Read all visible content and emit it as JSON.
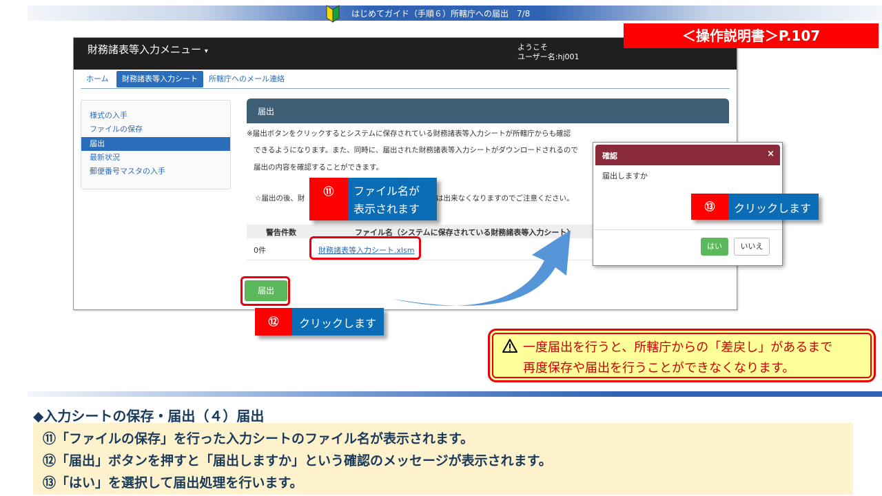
{
  "topbar": {
    "title": "はじめてガイド（手順６）所轄庁への届出　7/8"
  },
  "manual_ref": "＜操作説明書＞P.107",
  "app": {
    "title": "財務諸表等入力メニュー",
    "caret": "▾",
    "welcome_line1": "ようこそ",
    "welcome_line2": "ユーザー名:hj001"
  },
  "nav": {
    "home": "ホーム",
    "input_sheet": "財務諸表等入力シート",
    "mail": "所轄庁へのメール連絡"
  },
  "sidebar": {
    "items": [
      {
        "label": "様式の入手"
      },
      {
        "label": "ファイルの保存"
      },
      {
        "label": "届出"
      },
      {
        "label": "最新状況"
      },
      {
        "label": "郵便番号マスタの入手"
      }
    ]
  },
  "panel": {
    "header": "届出",
    "note1": "※届出ボタンをクリックするとシステムに保存されている財務諸表等入力シートが所轄庁からも確認",
    "note2": "できるようになります。また、同時に、届出された財務諸表等入力シートがダウンロードされるので",
    "note3": "届出の内容を確認することができます。",
    "note4_start": "☆届出の後、財",
    "note4_end": "は出来なくなりますのでご注意ください。"
  },
  "table": {
    "col_warnings": "警告件数",
    "col_filename": "ファイル名（システムに保存されている財務諸表等入力シート）",
    "row_warnings": "0件",
    "row_file": "財務諸表等入力シート.xlsm"
  },
  "submit_button": "届出",
  "callouts": {
    "c11_num": "⑪",
    "c11_line1": "ファイル名が",
    "c11_line2": "表示されます",
    "c12_num": "⑫",
    "c12_text": "クリックします",
    "c13_num": "⑬",
    "c13_text": "クリックします"
  },
  "dialog": {
    "title": "確認",
    "close": "×",
    "message": "届出しますか",
    "yes": "はい",
    "no": "いいえ"
  },
  "warning": {
    "line1": "一度届出を行うと、所轄庁からの「差戻し」があるまで",
    "line2": "再度保存や届出を行うことができなくなります。"
  },
  "section": {
    "title": "◆入力シートの保存・届出（４）届出",
    "step1": "⑪「ファイルの保存」を行った入力シートのファイル名が表示されます。",
    "step2": "⑫「届出」ボタンを押すと「届出しますか」という確認のメッセージが表示されます。",
    "step3": "⑬「はい」を選択して届出処理を行います。"
  },
  "colors": {
    "accent_red": "#e8000f",
    "brand_blue": "#2a6ebb",
    "callout_blue": "#0b6db5",
    "ok_green": "#5cb85c"
  }
}
